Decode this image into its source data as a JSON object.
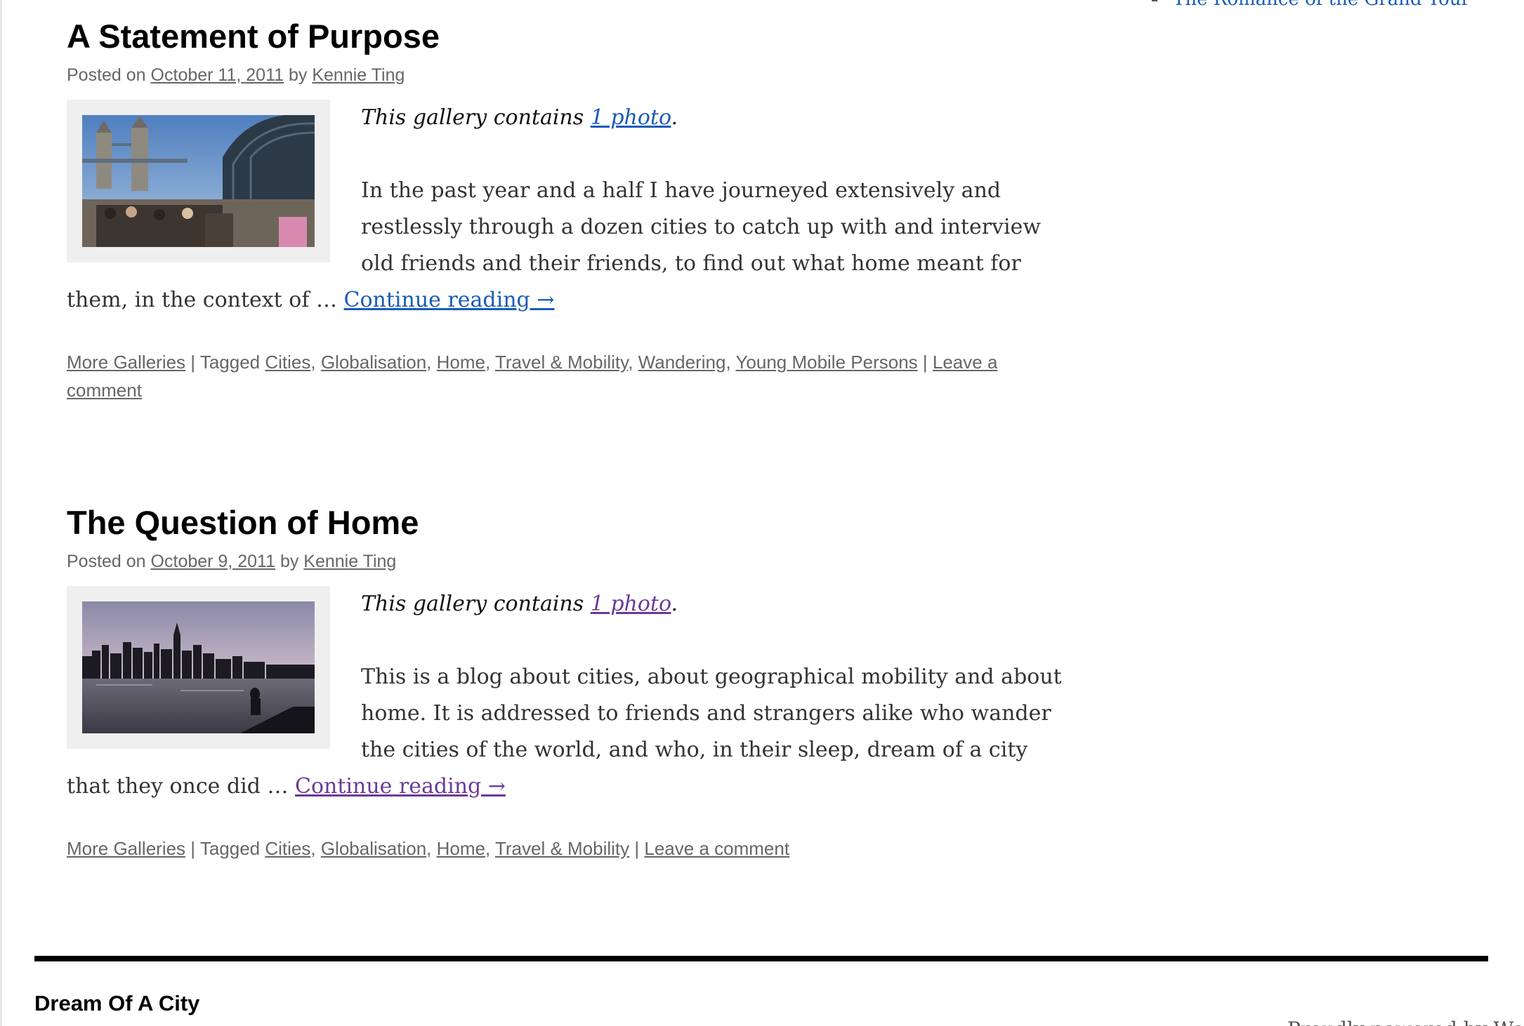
{
  "sidebar": {
    "items": [
      {
        "label": "The Romance of the Grand Tour"
      }
    ]
  },
  "posts": [
    {
      "title": "A Statement of Purpose",
      "posted_on_label": "Posted on",
      "date": "October 11, 2011",
      "by_label": "by",
      "author": "Kennie Ting",
      "gallery_prefix": "This gallery contains",
      "gallery_link": "1 photo",
      "gallery_suffix": ".",
      "excerpt": "In the past year and a half I have journeyed extensively and restlessly through a dozen cities to catch up with and interview old friends and their friends, to find out what home meant for them, in the context of … ",
      "continue_label": "Continue reading →",
      "category": "More Galleries",
      "tagged_label": "Tagged",
      "tags": [
        "Cities",
        "Globalisation",
        "Home",
        "Travel & Mobility",
        "Wandering",
        "Young Mobile Persons"
      ],
      "comment_label": "Leave a comment",
      "thumb_icon": "tower-bridge-photo"
    },
    {
      "title": "The Question of Home",
      "posted_on_label": "Posted on",
      "date": "October 9, 2011",
      "by_label": "by",
      "author": "Kennie Ting",
      "gallery_prefix": "This gallery contains",
      "gallery_link": "1 photo",
      "gallery_suffix": ".",
      "excerpt": "This is a blog about cities, about geographical mobility and about home. It is addressed to friends and strangers alike who wander the cities of the world, and who, in their sleep, dream of a city that they once did … ",
      "continue_label": "Continue reading →",
      "category": "More Galleries",
      "tagged_label": "Tagged",
      "tags": [
        "Cities",
        "Globalisation",
        "Home",
        "Travel & Mobility"
      ],
      "comment_label": "Leave a comment",
      "thumb_icon": "city-skyline-photo"
    }
  ],
  "footer": {
    "site_title": "Dream Of A City",
    "powered_by": "Proudly powered by WordPress"
  },
  "colors": {
    "link_blue": "#1a5bb8",
    "link_visited": "#6b3a96",
    "meta_gray": "#666666",
    "rule": "#000000"
  }
}
